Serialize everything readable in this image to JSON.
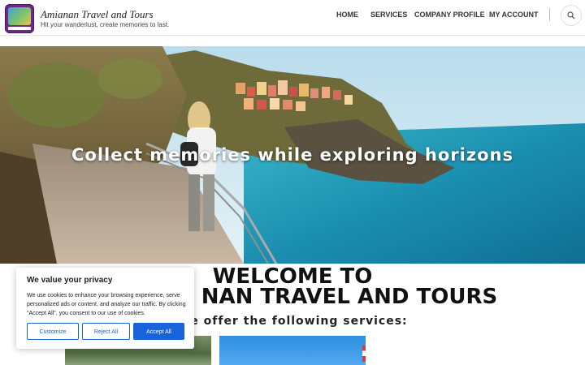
{
  "header": {
    "site_title": "Amianan Travel and Tours",
    "tagline": "Hit your wanderlust, create memories to last.",
    "nav": [
      "HOME",
      "SERVICES",
      "COMPANY PROFILE",
      "MY ACCOUNT"
    ],
    "icons": {
      "logo": "amianan-logo",
      "search": "search-icon"
    }
  },
  "hero": {
    "headline": "Collect memories while exploring horizons"
  },
  "welcome": {
    "line1": "WELCOME TO",
    "line2": "AMIANAN TRAVEL AND TOURS",
    "line2_visible": "NAN TRAVEL AND TOURS",
    "offer": "We offer the following services:"
  },
  "cookie_banner": {
    "title": "We value your privacy",
    "text": "We use cookies to enhance your browsing experience, serve personalized ads or content, and analyze our traffic. By clicking \"Accept All\", you consent to our use of cookies.",
    "buttons": {
      "customize": "Customize",
      "reject": "Reject All",
      "accept": "Accept All"
    },
    "accent": "#1863dc"
  }
}
